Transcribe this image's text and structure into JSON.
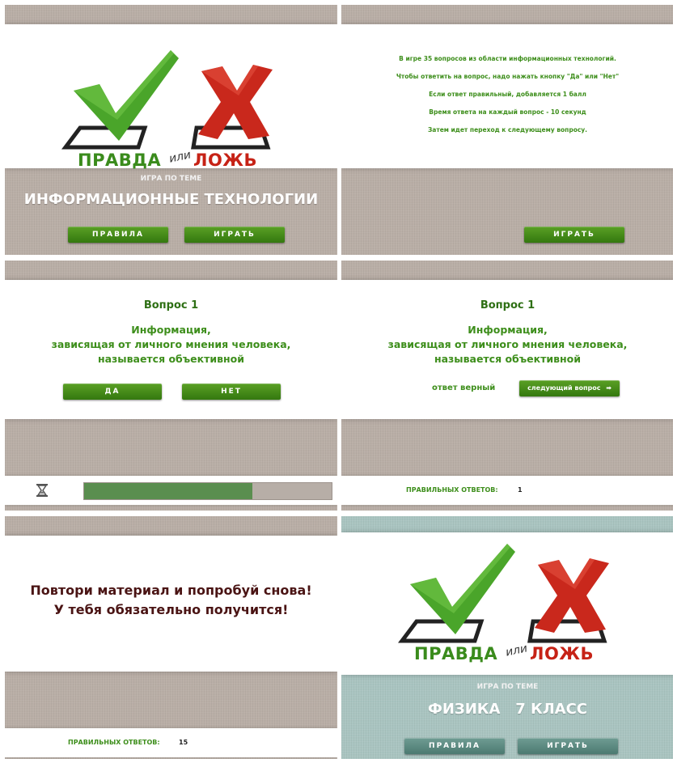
{
  "logo": {
    "word_true": "ПРАВДА",
    "word_or": "или",
    "word_false": "ЛОЖЬ",
    "true_color": "#3a8b1c",
    "false_color": "#c62216",
    "check_icon": "green-checkmark-icon",
    "cross_icon": "red-x-icon"
  },
  "slide1": {
    "subtitle": "ИГРА ПО ТЕМЕ",
    "title": "ИНФОРМАЦИОННЫЕ ТЕХНОЛОГИИ",
    "rules_button": "ПРАВИЛА",
    "play_button": "ИГРАТЬ"
  },
  "slide2": {
    "rules": [
      "В игре 35 вопросов из области информационных технологий.",
      "Чтобы ответить на вопрос, надо нажать кнопку \"Да\" или \"Нет\"",
      "Если ответ правильный, добавляется 1 балл",
      "Время ответа на каждый вопрос - 10 секунд",
      "Затем идет переход к следующему вопросу."
    ],
    "play_button": "ИГРАТЬ"
  },
  "slide3": {
    "question_title": "Вопрос 1",
    "question_lines": [
      "Информация,",
      "зависящая от личного мнения человека,",
      "называется объективной"
    ],
    "yes_button": "ДА",
    "no_button": "НЕТ",
    "timer_icon": "hourglass-icon",
    "timer_progress": 0.68
  },
  "slide4": {
    "question_title": "Вопрос 1",
    "question_lines": [
      "Информация,",
      "зависящая от личного мнения человека,",
      "называется объективной"
    ],
    "answer_status": "ответ верный",
    "next_button": "следующий вопрос",
    "next_icon": "arrow-right-icon",
    "correct_label": "ПРАВИЛЬНЫХ ОТВЕТОВ:",
    "correct_value": "1"
  },
  "slide5": {
    "message_line1": "Повтори материал и попробуй снова!",
    "message_line2": "У тебя обязательно получится!",
    "correct_label": "ПРАВИЛЬНЫХ ОТВЕТОВ:",
    "correct_value": "15"
  },
  "slide6": {
    "subtitle": "ИГРА ПО ТЕМЕ",
    "title": "ФИЗИКА   7 КЛАСС",
    "rules_button": "ПРАВИЛА",
    "play_button": "ИГРАТЬ"
  }
}
